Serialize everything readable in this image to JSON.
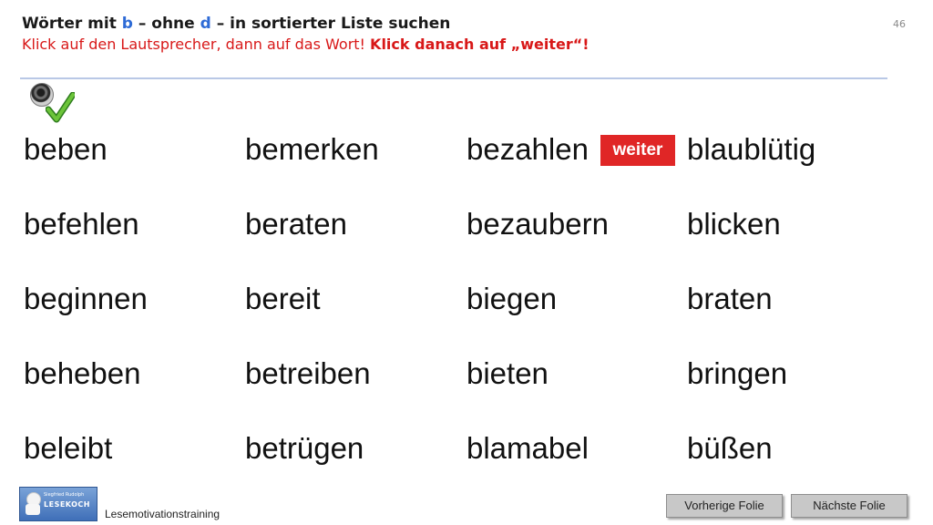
{
  "header": {
    "title": {
      "part1": "Wörter mit ",
      "letter1": "b",
      "part2": " – ohne ",
      "letter2": "d",
      "part3": " – in sortierter Liste suchen"
    },
    "instruction": {
      "normal": "Klick auf den Lautsprecher, dann auf das Wort! ",
      "bold": "Klick danach auf „weiter“!"
    }
  },
  "slide_number": "46",
  "colors": {
    "instruction": "#d81818",
    "highlight_letter": "#2e6bd6",
    "weiter_button": "#e02626",
    "check": "#5fb32d"
  },
  "icons": {
    "speaker": "speaker-icon",
    "check": "checkmark-icon"
  },
  "word_columns": [
    [
      "beben",
      "befehlen",
      "beginnen",
      "beheben",
      "beleibt"
    ],
    [
      "bemerken",
      "beraten",
      "bereit",
      "betreiben",
      "betrügen"
    ],
    [
      "bezahlen",
      "bezaubern",
      "biegen",
      "bieten",
      "blamabel"
    ],
    [
      "blaublütig",
      "blicken",
      "braten",
      "bringen",
      "büßen"
    ]
  ],
  "weiter_label": "weiter",
  "footer": {
    "logo": {
      "small_text": "Siegfried Rudolph",
      "big_text": "LESEKOCH"
    },
    "label": "Lesemotivationstraining",
    "prev_label": "Vorherige  Folie",
    "next_label": "Nächste  Folie"
  }
}
